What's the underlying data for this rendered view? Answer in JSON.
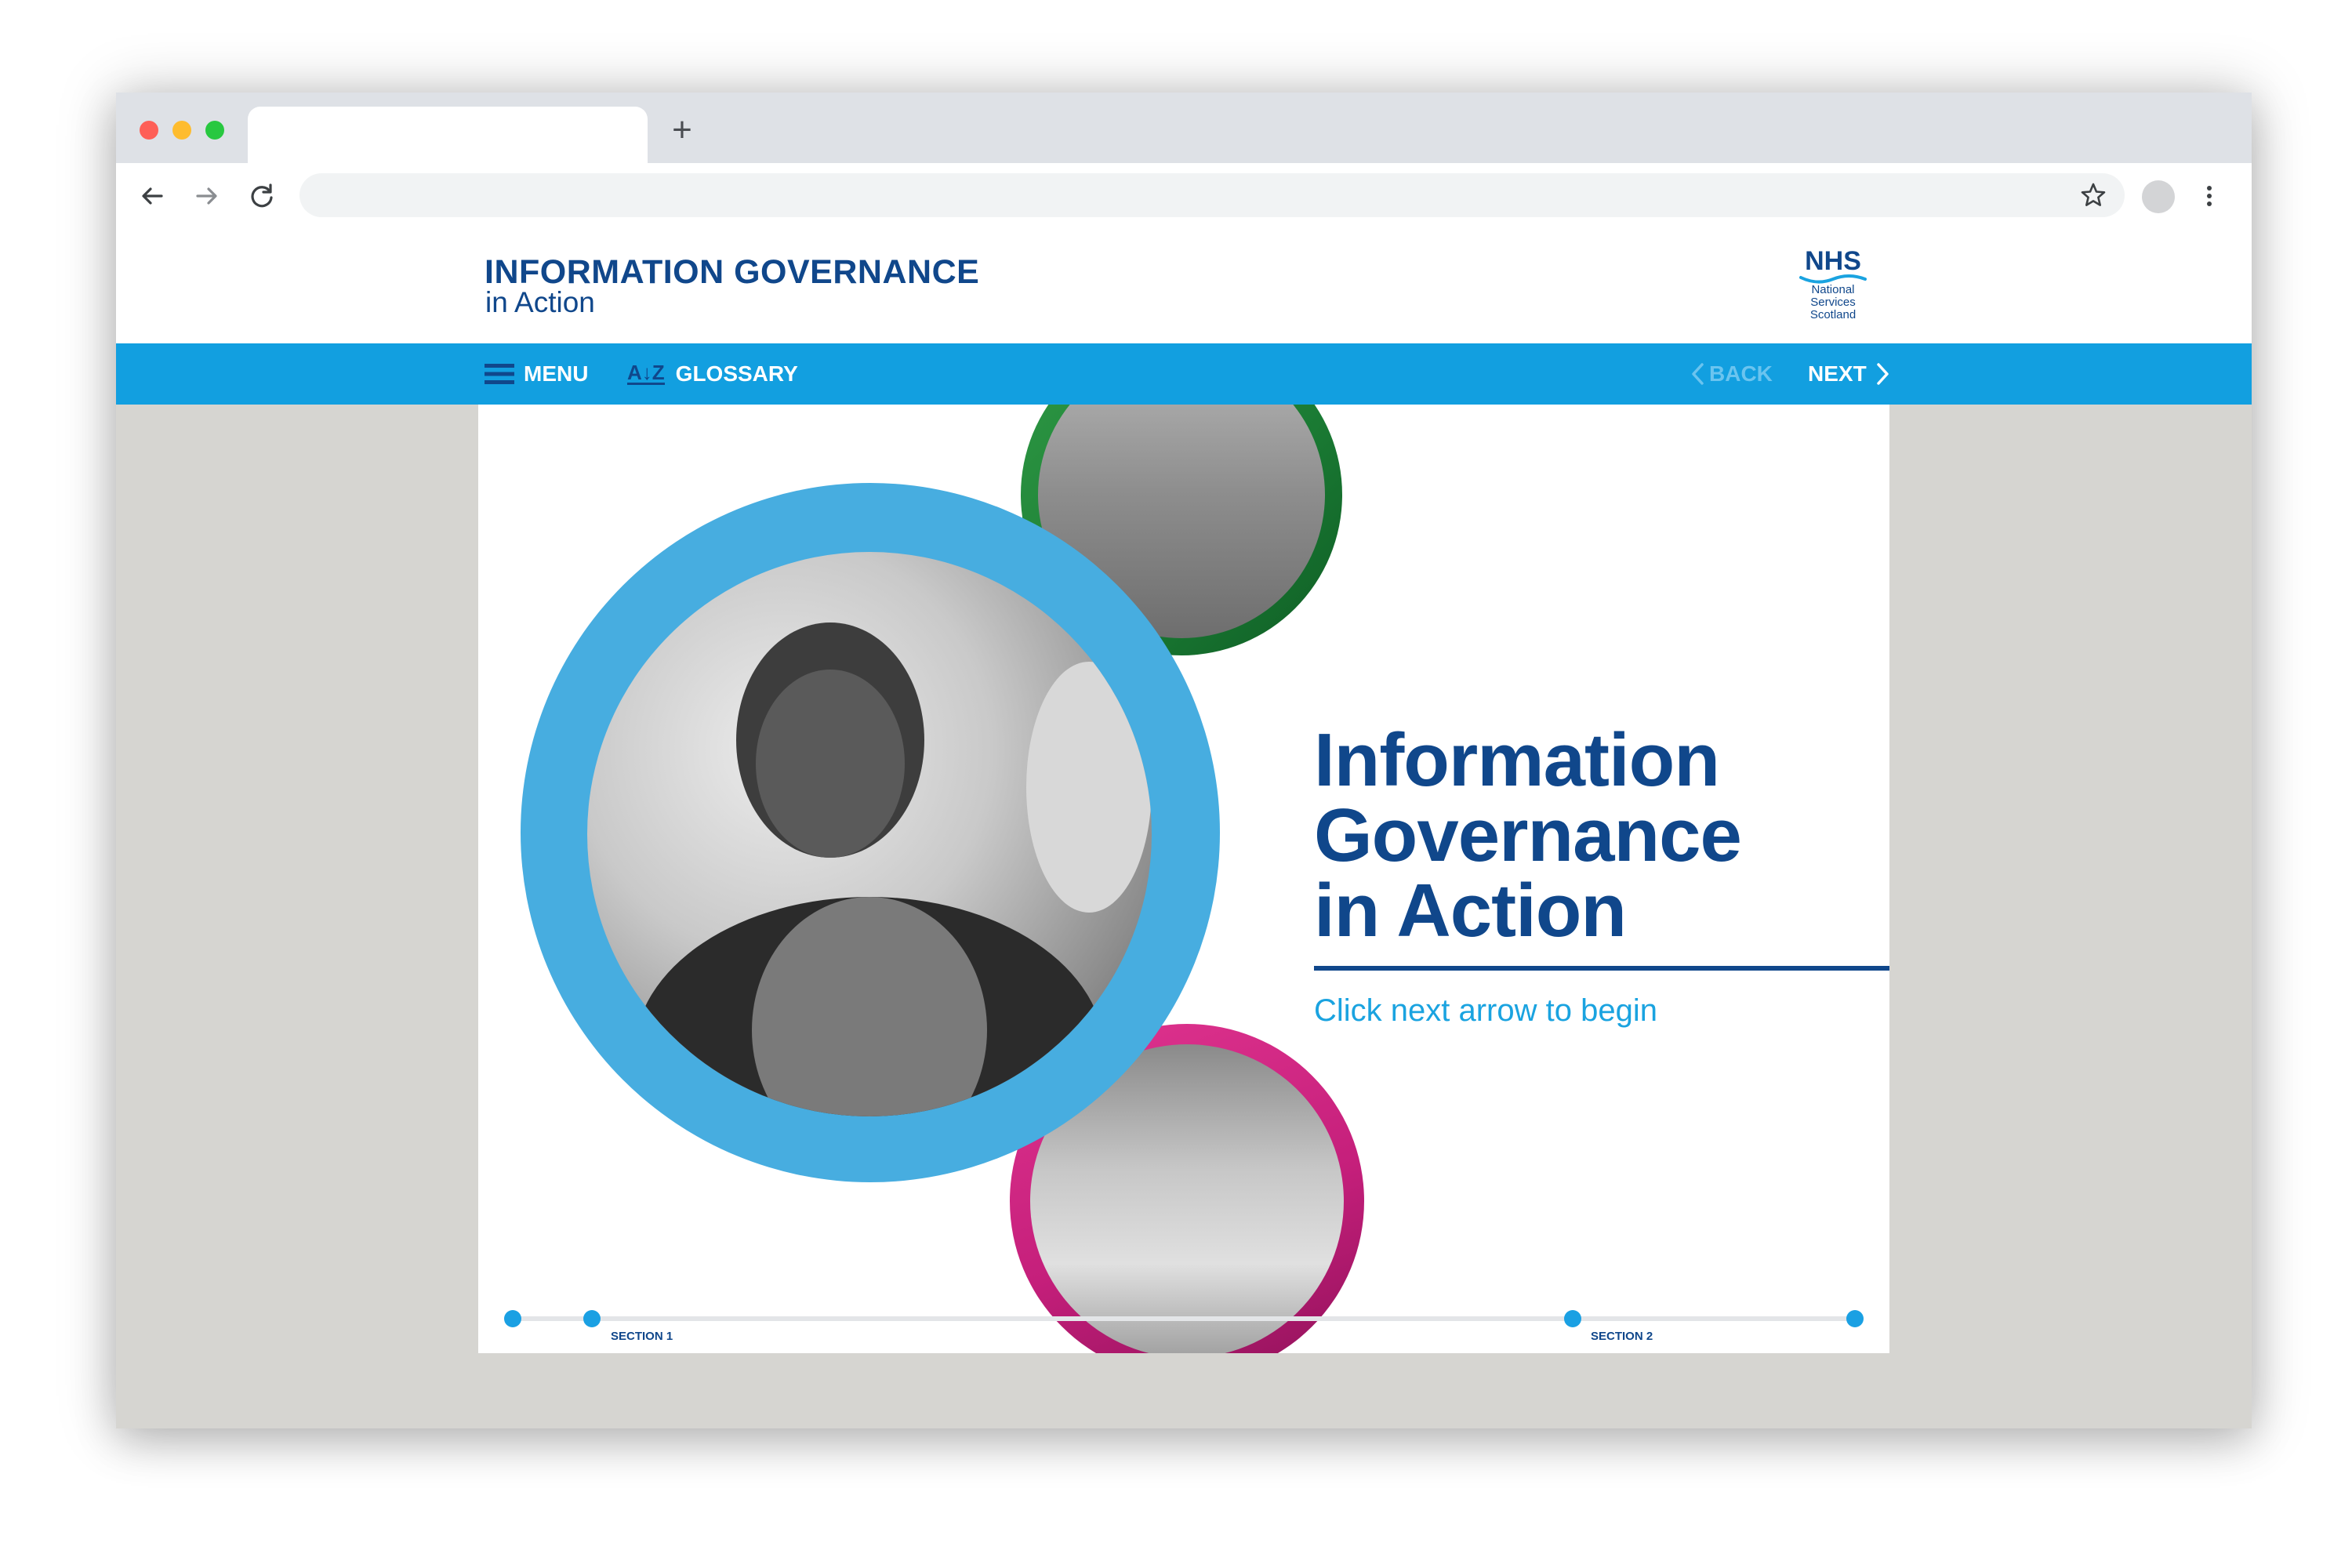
{
  "browser": {
    "new_tab_label": "+",
    "address": ""
  },
  "site": {
    "title": "INFORMATION GOVERNANCE",
    "subtitle": "in Action",
    "logo": {
      "word": "NHS",
      "line1": "National",
      "line2": "Services",
      "line3": "Scotland"
    }
  },
  "nav": {
    "menu_label": "MENU",
    "glossary_icon_text": "A↓Z",
    "glossary_label": "GLOSSARY",
    "back_label": "BACK",
    "next_label": "NEXT"
  },
  "slide": {
    "title_line1": "Information",
    "title_line2": "Governance",
    "title_line3": "in Action",
    "cta": "Click next arrow to begin",
    "images": [
      "hero-photo-staff-smiling",
      "warehouse-photo",
      "lab-photo"
    ]
  },
  "progress": {
    "sections": [
      {
        "label": "SECTION 1"
      },
      {
        "label": "SECTION 2"
      }
    ]
  },
  "colors": {
    "brand_navy": "#10478b",
    "nav_blue": "#129fe0",
    "accent_cyan": "#1aa3e0",
    "ring_blue": "#47ade0",
    "ring_green": "#2f9a45",
    "ring_pink": "#c51f7b",
    "page_bg": "#d6d5d1"
  }
}
